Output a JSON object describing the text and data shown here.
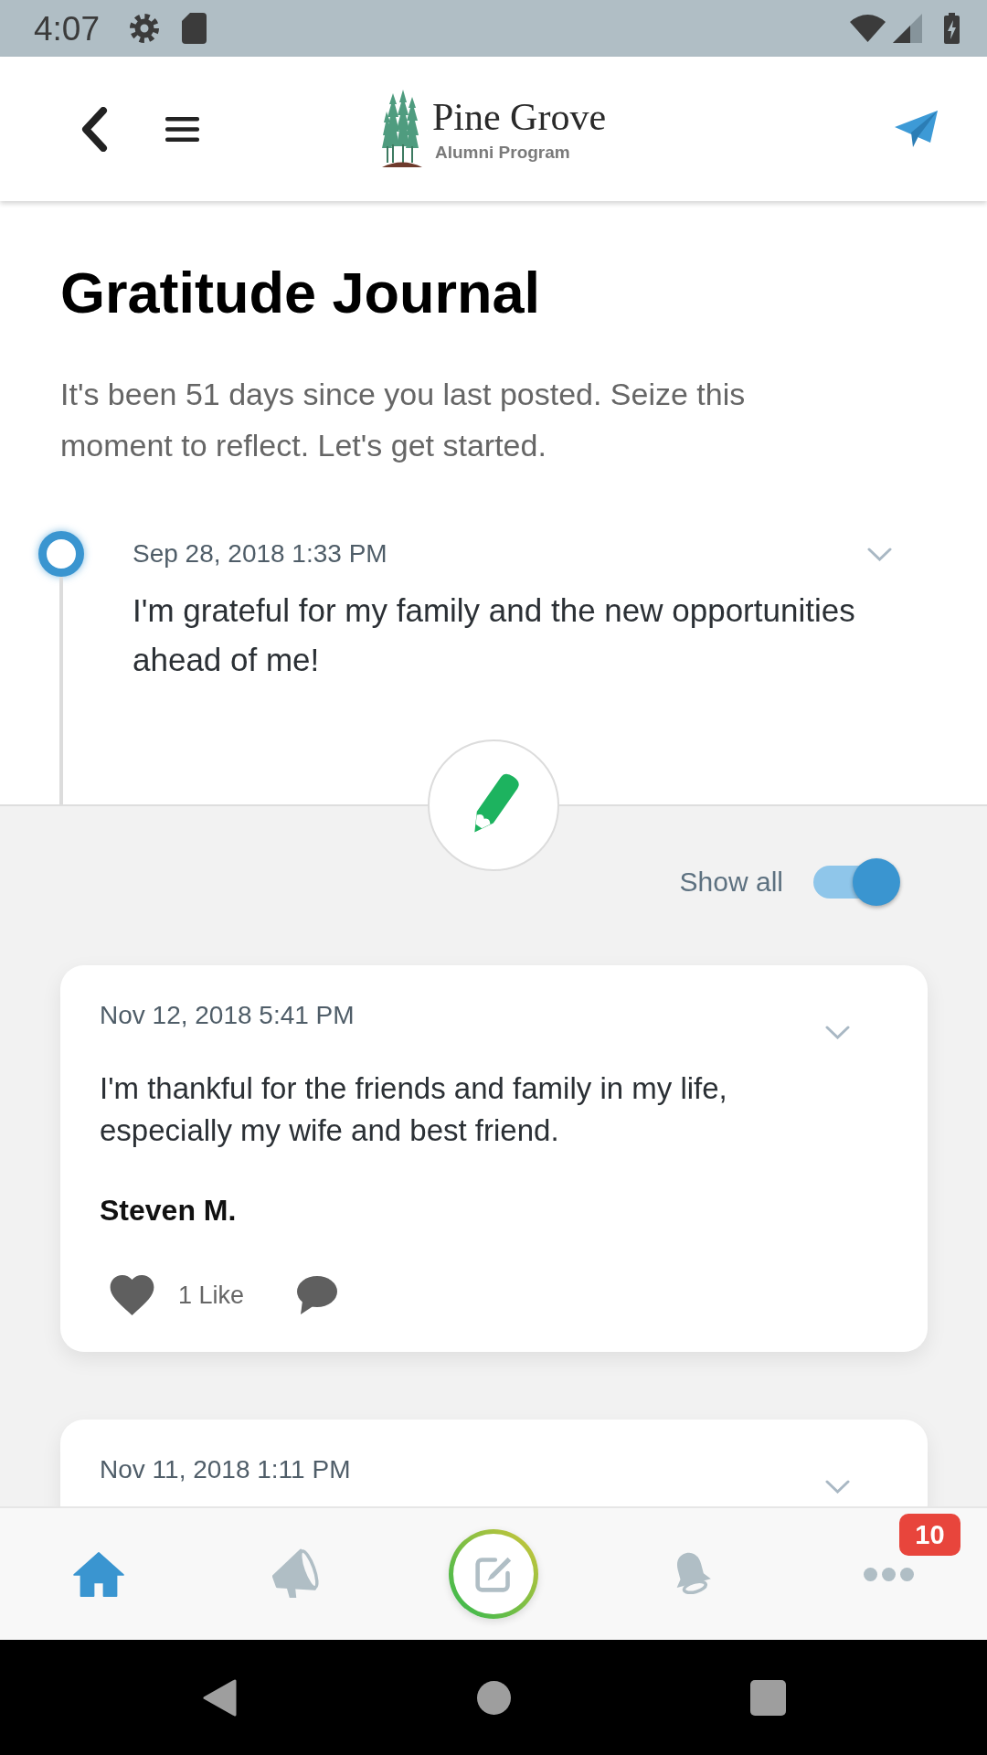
{
  "status_bar": {
    "time": "4:07"
  },
  "header": {
    "logo_title": "Pine Grove",
    "logo_subtitle": "Alumni Program"
  },
  "page": {
    "title": "Gratitude Journal",
    "intro": "It's been 51 days since you last posted. Seize this moment to reflect. Let's get started."
  },
  "latest_entry": {
    "date": "Sep 28, 2018 1:33 PM",
    "text": "I'm grateful for my family and the new opportunities ahead of me!"
  },
  "show_all": {
    "label": "Show all",
    "on": true
  },
  "entries": [
    {
      "date": "Nov 12, 2018 5:41 PM",
      "text": "I'm thankful for the friends and family in my life, especially my wife and best friend.",
      "author": "Steven M.",
      "likes": "1 Like"
    },
    {
      "date": "Nov 11, 2018 1:11 PM"
    }
  ],
  "bottom_nav": [
    {
      "kind": "home",
      "selected": true
    },
    {
      "kind": "megaphone",
      "selected": false
    },
    {
      "kind": "compose",
      "selected": false
    },
    {
      "kind": "bell",
      "selected": false
    },
    {
      "kind": "more",
      "selected": false,
      "badge": "10"
    }
  ]
}
